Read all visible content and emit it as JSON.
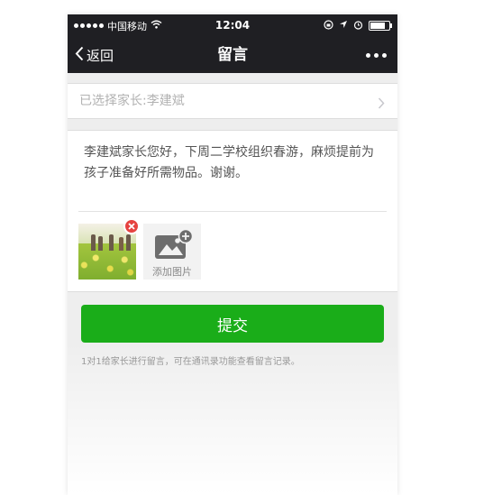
{
  "status_bar": {
    "carrier": "中国移动",
    "time": "12:04",
    "battery_level": 0.9
  },
  "nav": {
    "back_label": "返回",
    "title": "留言"
  },
  "recipient": {
    "label": "已选择家长:李建斌"
  },
  "compose": {
    "message": "李建斌家长您好，下周二学校组织春游，麻烦提前为孩子准备好所需物品。谢谢。",
    "add_image_label": "添加图片"
  },
  "submit": {
    "label": "提交"
  },
  "hint": "1对1给家长进行留言，可在通讯录功能查看留言记录。",
  "colors": {
    "bar_bg": "#1f1f23",
    "accent_green": "#1aad19",
    "delete_red": "#e64340"
  }
}
